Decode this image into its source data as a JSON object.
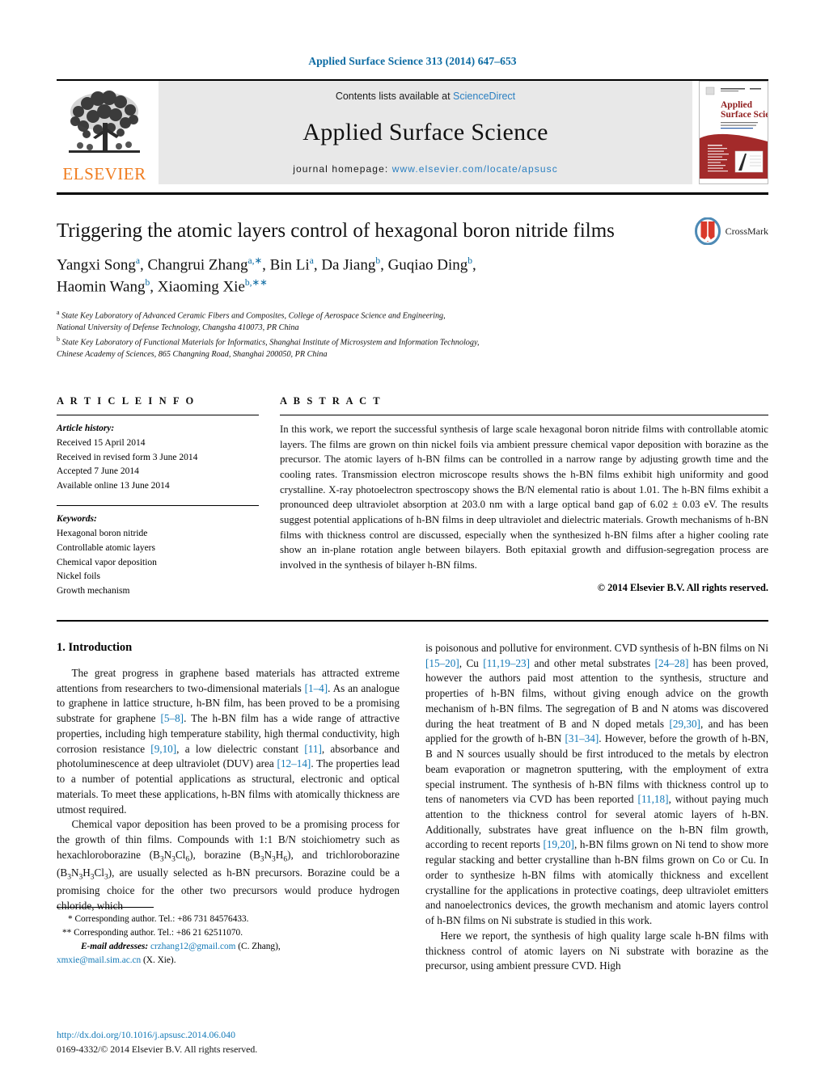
{
  "journal_ref": "Applied Surface Science 313 (2014) 647–653",
  "masthead": {
    "publisher_name": "ELSEVIER",
    "contents_prefix": "Contents lists available at ",
    "contents_link": "ScienceDirect",
    "journal_title": "Applied Surface Science",
    "homepage_prefix": "journal homepage: ",
    "homepage_url": "www.elsevier.com/locate/apsusc",
    "cover_title_line1": "Applied",
    "cover_title_line2": "Surface Science"
  },
  "article": {
    "title": "Triggering the atomic layers control of hexagonal boron nitride films",
    "crossmark_label": "CrossMark",
    "authors_line1": "Yangxi Song",
    "authors_line1_sup1": "a",
    "authors_html": "Yangxi Song<sup>a</sup>, Changrui Zhang<sup>a,∗</sup>, Bin Li<sup>a</sup>, Da Jiang<sup>b</sup>, Guqiao Ding<sup>b</sup>,<br>Haomin Wang<sup>b</sup>, Xiaoming Xie<sup>b,∗∗</sup>",
    "affiliation_a_line1": "State Key Laboratory of Advanced Ceramic Fibers and Composites, College of Aerospace Science and Engineering,",
    "affiliation_a_line2": "National University of Defense Technology, Changsha 410073, PR China",
    "affiliation_b_line1": "State Key Laboratory of Functional Materials for Informatics, Shanghai Institute of Microsystem and Information Technology,",
    "affiliation_b_line2": "Chinese Academy of Sciences, 865 Changning Road, Shanghai 200050, PR China"
  },
  "article_info": {
    "heading": "A R T I C L E   I N F O",
    "history_title": "Article history:",
    "history": [
      "Received 15 April 2014",
      "Received in revised form 3 June 2014",
      "Accepted 7 June 2014",
      "Available online 13 June 2014"
    ],
    "keywords_title": "Keywords:",
    "keywords": [
      "Hexagonal boron nitride",
      "Controllable atomic layers",
      "Chemical vapor deposition",
      "Nickel foils",
      "Growth mechanism"
    ]
  },
  "abstract": {
    "heading": "A B S T R A C T",
    "text": "In this work, we report the successful synthesis of large scale hexagonal boron nitride films with controllable atomic layers. The films are grown on thin nickel foils via ambient pressure chemical vapor deposition with borazine as the precursor. The atomic layers of h-BN films can be controlled in a narrow range by adjusting growth time and the cooling rates. Transmission electron microscope results shows the h-BN films exhibit high uniformity and good crystalline. X-ray photoelectron spectroscopy shows the B/N elemental ratio is about 1.01. The h-BN films exhibit a pronounced deep ultraviolet absorption at 203.0 nm with a large optical band gap of 6.02 ± 0.03 eV. The results suggest potential applications of h-BN films in deep ultraviolet and dielectric materials. Growth mechanisms of h-BN films with thickness control are discussed, especially when the synthesized h-BN films after a higher cooling rate show an in-plane rotation angle between bilayers. Both epitaxial growth and diffusion-segregation process are involved in the synthesis of bilayer h-BN films.",
    "copyright": "© 2014 Elsevier B.V. All rights reserved."
  },
  "body": {
    "section_title": "1.  Introduction",
    "left_paragraphs": [
      "The great progress in graphene based materials has attracted extreme attentions from researchers to two-dimensional materials <span class=\"ref\">[1–4]</span>. As an analogue to graphene in lattice structure, h-BN film, has been proved to be a promising substrate for graphene <span class=\"ref\">[5–8]</span>. The h-BN film has a wide range of attractive properties, including high temperature stability, high thermal conductivity, high corrosion resistance <span class=\"ref\">[9,10]</span>, a low dielectric constant <span class=\"ref\">[11]</span>, absorbance and photoluminescence at deep ultraviolet (DUV) area <span class=\"ref\">[12–14]</span>. The properties lead to a number of potential applications as structural, electronic and optical materials. To meet these applications, h-BN films with atomically thickness are utmost required.",
      "Chemical vapor deposition has been proved to be a promising process for the growth of thin films. Compounds with 1:1 B/N stoichiometry such as hexachloroborazine (B<sub>3</sub>N<sub>3</sub>Cl<sub>6</sub>), borazine (B<sub>3</sub>N<sub>3</sub>H<sub>6</sub>), and trichloroborazine (B<sub>3</sub>N<sub>3</sub>H<sub>3</sub>Cl<sub>3</sub>), are usually selected as h-BN precursors. Borazine could be a promising choice for the other two precursors would produce hydrogen chloride, which"
    ],
    "right_paragraphs": [
      "is poisonous and pollutive for environment. CVD synthesis of h-BN films on Ni <span class=\"ref\">[15–20]</span>, Cu <span class=\"ref\">[11,19–23]</span> and other metal substrates <span class=\"ref\">[24–28]</span> has been proved, however the authors paid most attention to the synthesis, structure and properties of h-BN films, without giving enough advice on the growth mechanism of h-BN films. The segregation of B and N atoms was discovered during the heat treatment of B and N doped metals <span class=\"ref\">[29,30]</span>, and has been applied for the growth of h-BN <span class=\"ref\">[31–34]</span>. However, before the growth of h-BN, B and N sources usually should be first introduced to the metals by electron beam evaporation or magnetron sputtering, with the employment of extra special instrument. The synthesis of h-BN films with thickness control up to tens of nanometers via CVD has been reported <span class=\"ref\">[11,18]</span>, without paying much attention to the thickness control for several atomic layers of h-BN. Additionally, substrates have great influence on the h-BN film growth, according to recent reports <span class=\"ref\">[19,20]</span>, h-BN films grown on Ni tend to show more regular stacking and better crystalline than h-BN films grown on Co or Cu. In order to synthesize h-BN films with atomically thickness and excellent crystalline for the applications in protective coatings, deep ultraviolet emitters and nanoelectronics devices, the growth mechanism and atomic layers control of h-BN films on Ni substrate is studied in this work.",
      "Here we report, the synthesis of high quality large scale h-BN films with thickness control of atomic layers on Ni substrate with borazine as the precursor, using ambient pressure CVD. High"
    ]
  },
  "footnotes": {
    "corresponding_1": "Corresponding author. Tel.: +86 731 84576433.",
    "corresponding_1_mark": "*",
    "corresponding_2": "Corresponding author. Tel.: +86 21 62511070.",
    "corresponding_2_mark": "**",
    "email_label": "E-mail addresses:",
    "email_1": "crzhang12@gmail.com",
    "email_1_owner": "(C. Zhang),",
    "email_2": "xmxie@mail.sim.ac.cn",
    "email_2_owner": "(X. Xie).",
    "doi": "http://dx.doi.org/10.1016/j.apsusc.2014.06.040",
    "issn_line": "0169-4332/© 2014 Elsevier B.V. All rights reserved."
  },
  "colors": {
    "link": "#1379b7",
    "journal_ref": "#0b6aa2",
    "elsevier_orange": "#f07c1e",
    "masthead_gray": "#e8e8e8",
    "cover_red": "#a32a2a"
  }
}
